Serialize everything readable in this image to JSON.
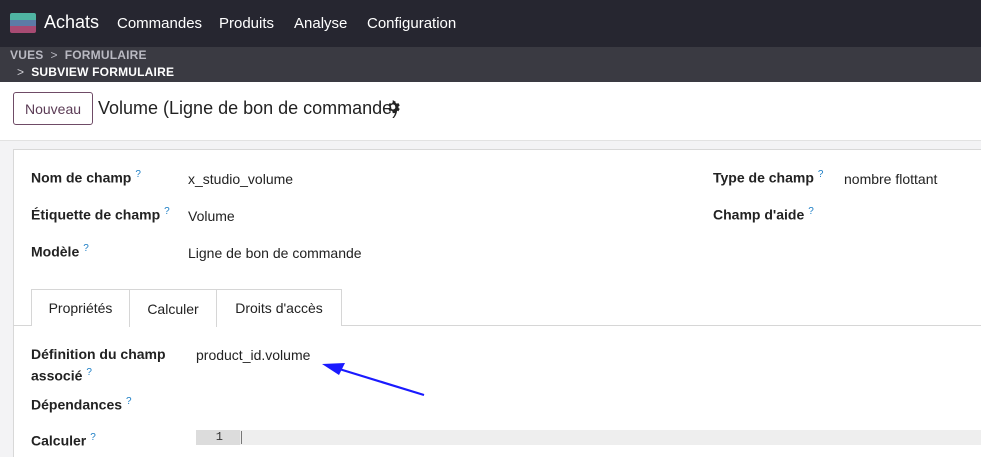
{
  "navbar": {
    "app_name": "Achats",
    "menu": [
      "Commandes",
      "Produits",
      "Analyse",
      "Configuration"
    ]
  },
  "breadcrumb": {
    "items": [
      "VUES",
      "FORMULAIRE"
    ],
    "current": "SUBVIEW FORMULAIRE"
  },
  "control": {
    "new_button": "Nouveau",
    "record_title": "Volume (Ligne de bon de commande)"
  },
  "form": {
    "fields_left": [
      {
        "label": "Nom de champ",
        "help": "?",
        "value": "x_studio_volume"
      },
      {
        "label": "Étiquette de champ",
        "help": "?",
        "value": "Volume"
      },
      {
        "label": "Modèle",
        "help": "?",
        "value": "Ligne de bon de commande"
      }
    ],
    "fields_right": [
      {
        "label": "Type de champ",
        "help": "?",
        "value": "nombre flottant"
      },
      {
        "label": "Champ d'aide",
        "help": "?",
        "value": ""
      }
    ],
    "tabs": [
      "Propriétés",
      "Calculer",
      "Droits d'accès"
    ],
    "active_tab": "Calculer",
    "compute": {
      "related_label_line1": "Définition du champ",
      "related_label_line2": "associé",
      "related_help": "?",
      "related_value": "product_id.volume",
      "depends_label": "Dépendances",
      "depends_help": "?",
      "compute_label": "Calculer",
      "compute_help": "?",
      "line_number": "1"
    }
  },
  "colors": {
    "navbar_bg": "#262630",
    "breadcrumb_bg": "#3a3a42",
    "brand_button_border": "#6f4b66",
    "help_icon": "#1c7ec5",
    "annotation_arrow": "#1a1aff"
  }
}
